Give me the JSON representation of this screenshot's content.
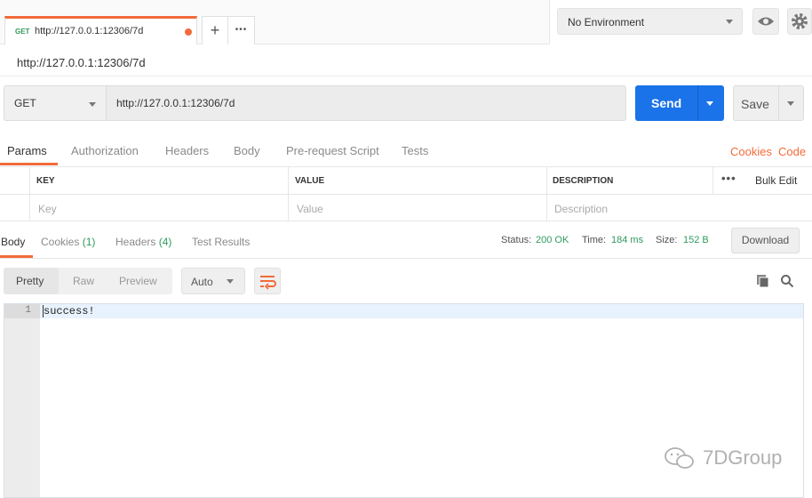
{
  "tab": {
    "method": "GET",
    "url": "http://127.0.0.1:12306/7d"
  },
  "tab_actions": {
    "new_tab": "+",
    "more": "•••"
  },
  "environment": {
    "selected": "No Environment"
  },
  "request": {
    "title": "http://127.0.0.1:12306/7d",
    "method": "GET",
    "url": "http://127.0.0.1:12306/7d",
    "send_label": "Send",
    "save_label": "Save"
  },
  "request_tabs": [
    "Params",
    "Authorization",
    "Headers",
    "Body",
    "Pre-request Script",
    "Tests"
  ],
  "request_links": {
    "cookies": "Cookies",
    "code": "Code"
  },
  "params_table": {
    "headers": [
      "KEY",
      "VALUE",
      "DESCRIPTION"
    ],
    "more": "•••",
    "bulk_edit": "Bulk Edit",
    "placeholders": [
      "Key",
      "Value",
      "Description"
    ]
  },
  "response_tabs": {
    "body": "Body",
    "cookies": "Cookies",
    "cookies_count": "(1)",
    "headers": "Headers",
    "headers_count": "(4)",
    "test_results": "Test Results"
  },
  "status": {
    "status_label": "Status:",
    "status_value": "200 OK",
    "time_label": "Time:",
    "time_value": "184 ms",
    "size_label": "Size:",
    "size_value": "152 B"
  },
  "download_label": "Download",
  "view_modes": [
    "Pretty",
    "Raw",
    "Preview"
  ],
  "format": "Auto",
  "editor": {
    "lines": [
      {
        "num": "1",
        "text": "success!"
      }
    ]
  },
  "watermark": "7DGroup",
  "colors": {
    "accent": "#f26b3a",
    "send": "#1a73e8",
    "success": "#2f9b5d"
  }
}
